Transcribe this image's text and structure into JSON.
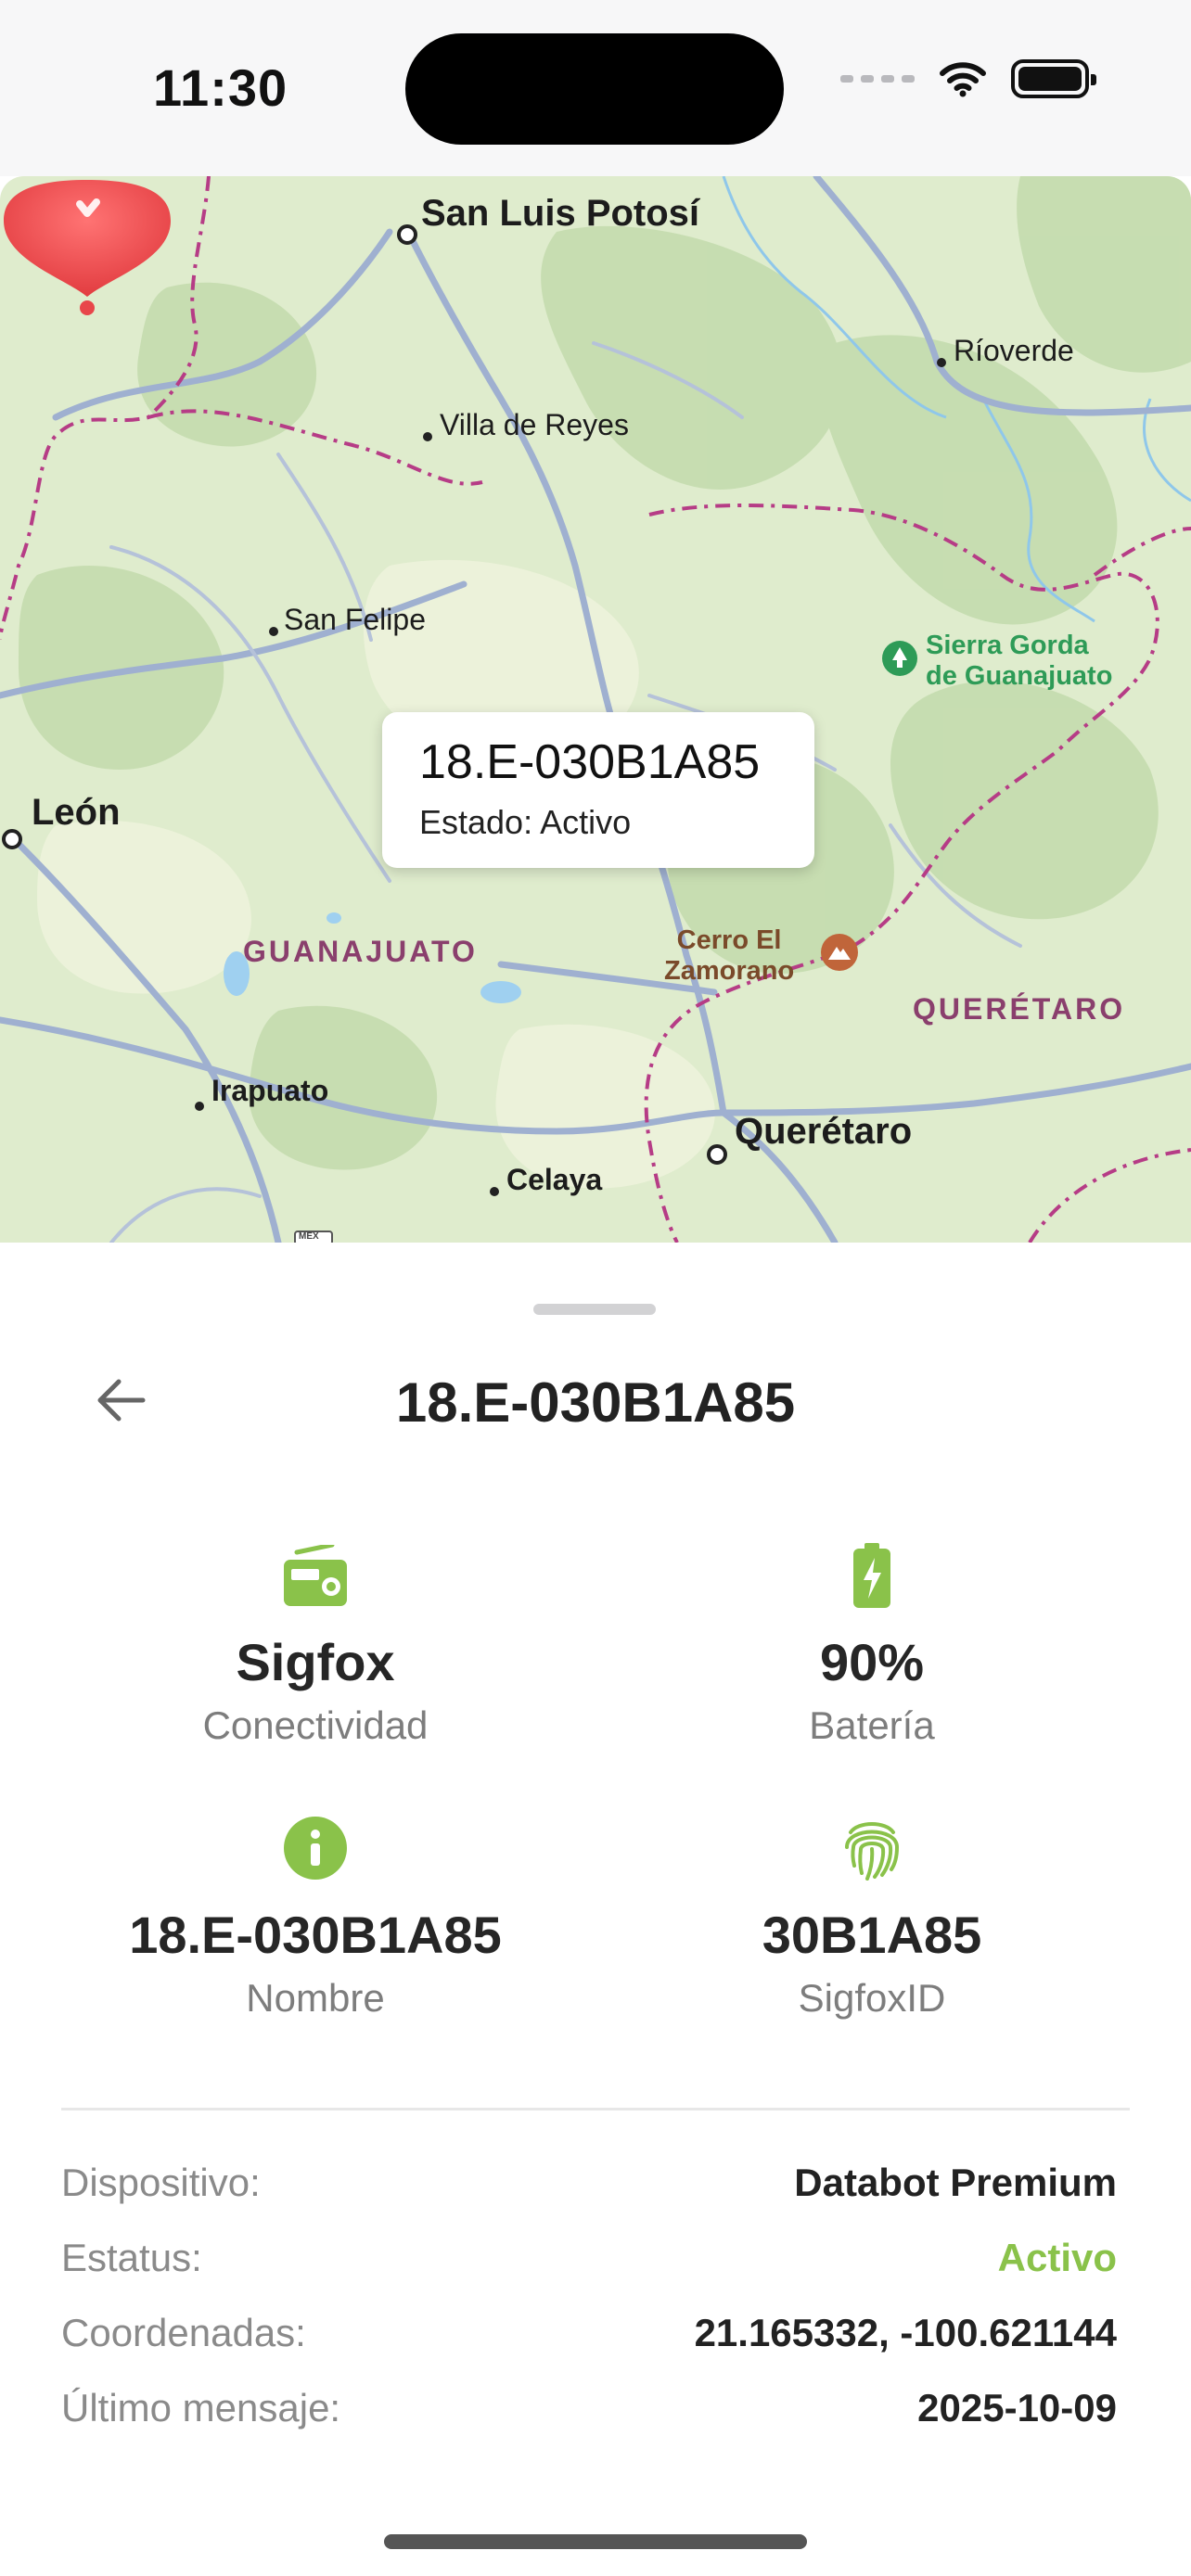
{
  "status_bar": {
    "time": "11:30"
  },
  "map": {
    "labels": {
      "san_luis_potosi": "San Luis Potosí",
      "rioverde": "Ríoverde",
      "villa_de_reyes": "Villa de Reyes",
      "san_felipe": "San Felipe",
      "sierra_gorda": "Sierra Gorda\nde Guanajuato",
      "leon": "León",
      "guanajuato": "GUANAJUATO",
      "cerro_el_zamorano": "Cerro El\nZamorano",
      "queretaro_state": "QUERÉTARO",
      "irapuato": "Irapuato",
      "queretaro": "Querétaro",
      "celaya": "Celaya",
      "mex_shield": "MEX"
    },
    "callout": {
      "title": "18.E-030B1A85",
      "subtitle": "Estado: Activo"
    },
    "pin_color": "#e8464a"
  },
  "sheet": {
    "title": "18.E-030B1A85",
    "stats": [
      {
        "icon": "radio-icon",
        "value": "Sigfox",
        "label": "Conectividad"
      },
      {
        "icon": "battery-charging-icon",
        "value": "90%",
        "label": "Batería"
      },
      {
        "icon": "info-icon",
        "value": "18.E-030B1A85",
        "label": "Nombre"
      },
      {
        "icon": "fingerprint-icon",
        "value": "30B1A85",
        "label": "SigfoxID"
      }
    ],
    "details": [
      {
        "key": "Dispositivo:",
        "value": "Databot Premium"
      },
      {
        "key": "Estatus:",
        "value": "Activo"
      },
      {
        "key": "Coordenadas:",
        "value": "21.165332, -100.621144"
      },
      {
        "key": "Último mensaje:",
        "value": "2025-10-09"
      }
    ],
    "accent_color": "#8ac24a"
  }
}
